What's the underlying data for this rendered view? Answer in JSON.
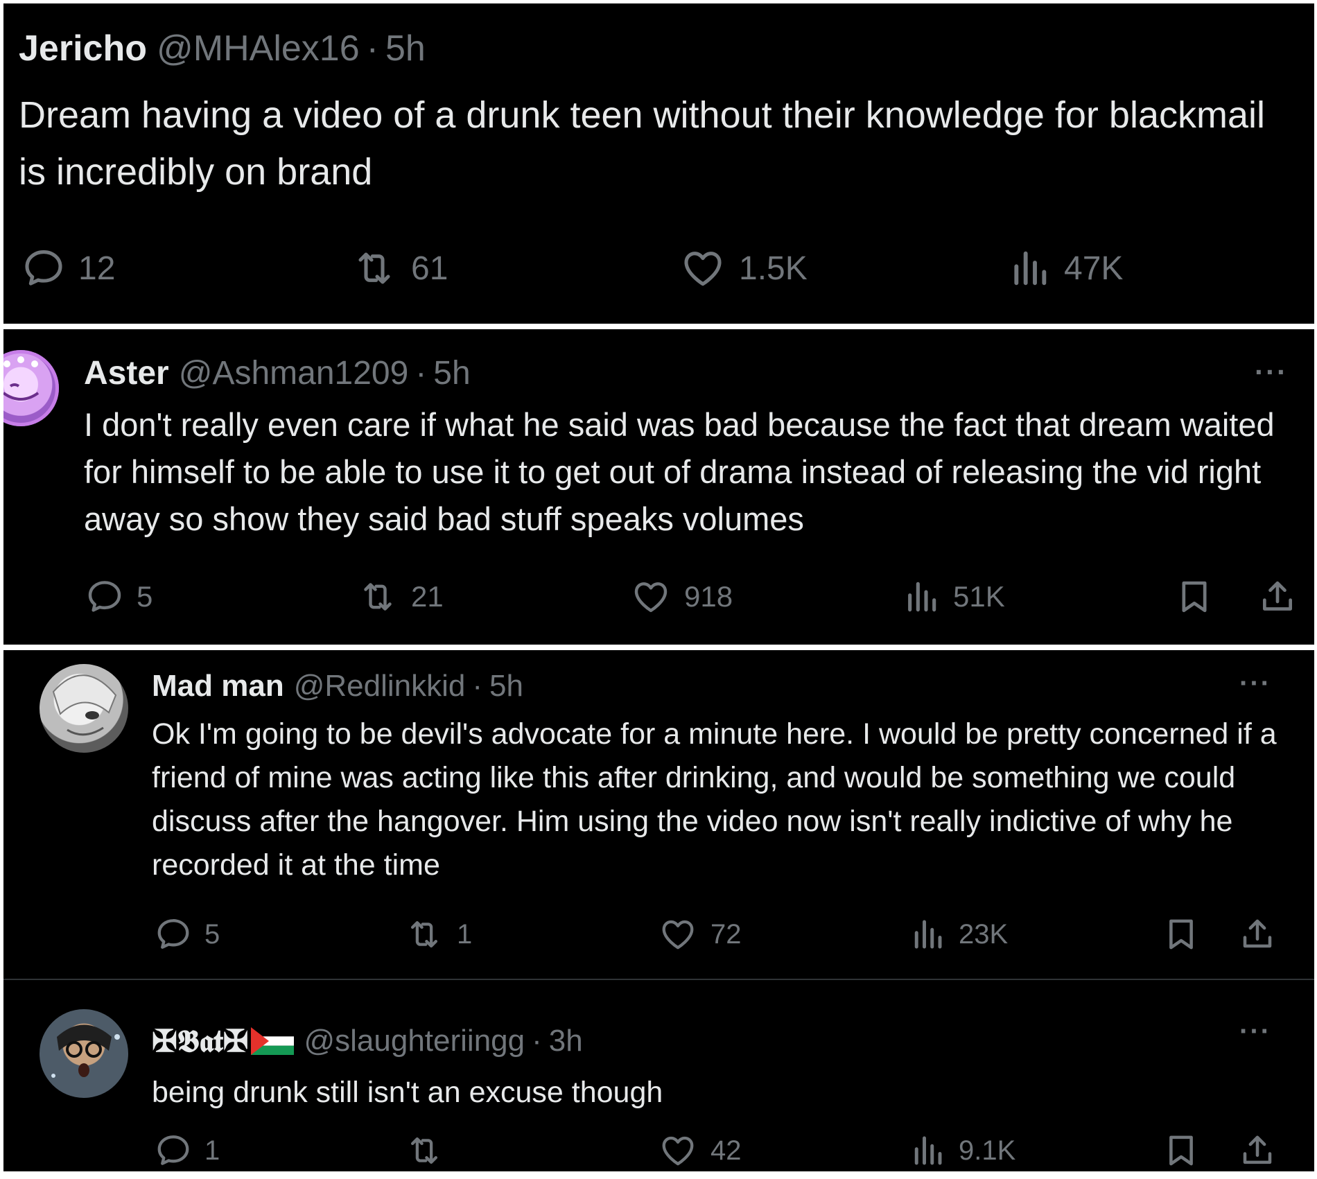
{
  "tweets": [
    {
      "name": "Jericho",
      "handle": "@MHAlex16",
      "separator": "·",
      "time": "5h",
      "text": "Dream having a video of a drunk teen without their knowledge for blackmail is incredibly on brand",
      "replies": "12",
      "reposts": "61",
      "likes": "1.5K",
      "views": "47K"
    },
    {
      "name": "Aster",
      "handle": "@Ashman1209",
      "separator": "·",
      "time": "5h",
      "more": "···",
      "text": "I don't really even care if what he said was bad because the fact that dream waited for himself to be able to use it to get out of drama instead of releasing the vid right away so show they said bad stuff speaks volumes",
      "replies": "5",
      "reposts": "21",
      "likes": "918",
      "views": "51K"
    },
    {
      "name": "Mad man",
      "handle": "@Redlinkkid",
      "separator": "·",
      "time": "5h",
      "more": "···",
      "text": "Ok I'm going to be devil's advocate for a minute here. I would be pretty concerned if a friend of mine was acting like this after drinking, and would be something we could discuss after the hangover. Him using the video now isn't really indictive of why he recorded it at the time",
      "replies": "5",
      "reposts": "1",
      "likes": "72",
      "views": "23K"
    },
    {
      "name": "✠𝕭𝖆𝖙✠",
      "handle": "@slaughteriingg",
      "separator": "·",
      "time": "3h",
      "more": "···",
      "text": "being drunk still isn't an excuse though",
      "replies": "1",
      "reposts": "",
      "likes": "42",
      "views": "9.1K"
    }
  ],
  "icons": {
    "reply": "reply-icon",
    "repost": "repost-icon",
    "like": "heart-icon",
    "views": "views-icon",
    "bookmark": "bookmark-icon",
    "share": "share-icon",
    "flag": "palestine-flag-icon"
  },
  "colors": {
    "background": "#000000",
    "primary_text": "#e7e9ea",
    "secondary_text": "#71767b",
    "divider": "#2f3336"
  }
}
